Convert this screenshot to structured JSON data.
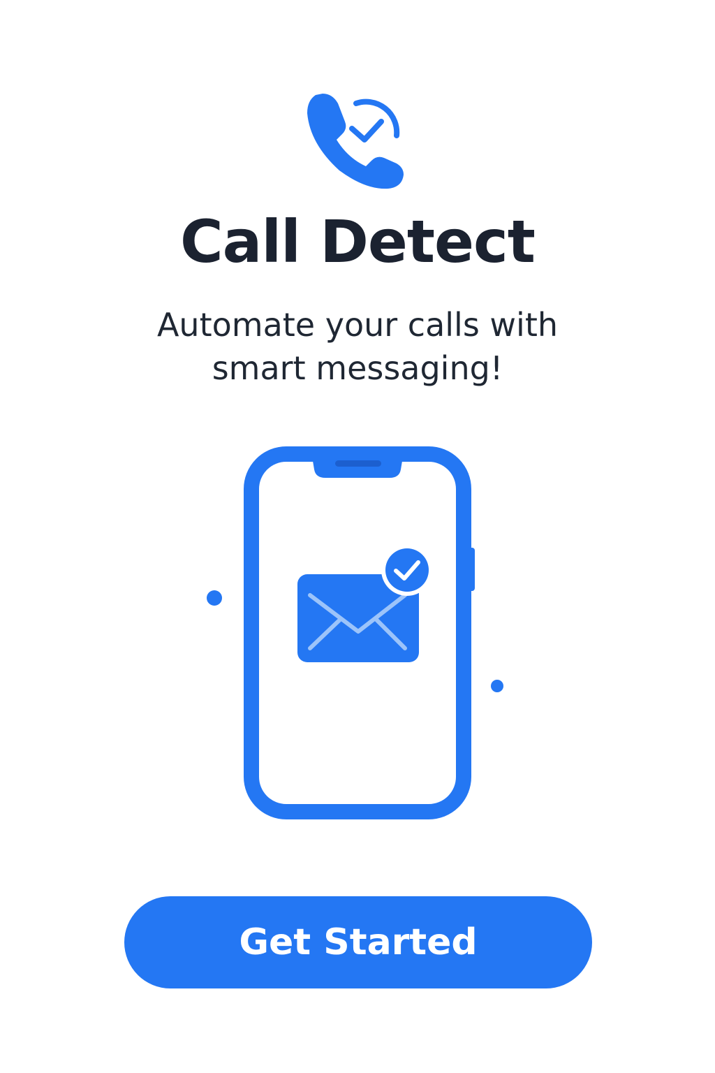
{
  "app": {
    "title": "Call Detect",
    "tagline_line1": "Automate your calls with",
    "tagline_line2": "smart messaging!"
  },
  "icons": {
    "logo": "phone-check-icon",
    "illustration_device": "smartphone-icon",
    "illustration_message": "envelope-icon",
    "illustration_badge": "checkmark-icon"
  },
  "cta": {
    "label": "Get Started"
  },
  "colors": {
    "accent": "#2477f3",
    "accent_light": "#9cc4fa",
    "text_dark": "#1b2230",
    "background": "#ffffff"
  }
}
